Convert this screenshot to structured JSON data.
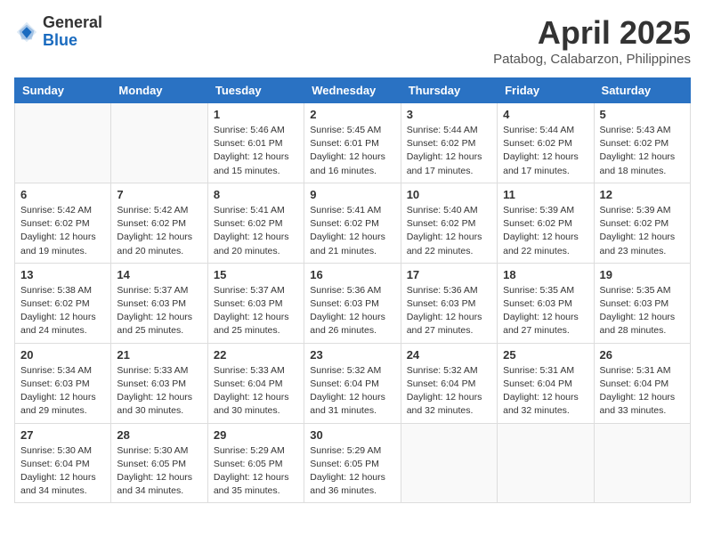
{
  "header": {
    "logo_general": "General",
    "logo_blue": "Blue",
    "month": "April 2025",
    "location": "Patabog, Calabarzon, Philippines"
  },
  "columns": [
    "Sunday",
    "Monday",
    "Tuesday",
    "Wednesday",
    "Thursday",
    "Friday",
    "Saturday"
  ],
  "weeks": [
    [
      {
        "day": "",
        "info": ""
      },
      {
        "day": "",
        "info": ""
      },
      {
        "day": "1",
        "info": "Sunrise: 5:46 AM\nSunset: 6:01 PM\nDaylight: 12 hours and 15 minutes."
      },
      {
        "day": "2",
        "info": "Sunrise: 5:45 AM\nSunset: 6:01 PM\nDaylight: 12 hours and 16 minutes."
      },
      {
        "day": "3",
        "info": "Sunrise: 5:44 AM\nSunset: 6:02 PM\nDaylight: 12 hours and 17 minutes."
      },
      {
        "day": "4",
        "info": "Sunrise: 5:44 AM\nSunset: 6:02 PM\nDaylight: 12 hours and 17 minutes."
      },
      {
        "day": "5",
        "info": "Sunrise: 5:43 AM\nSunset: 6:02 PM\nDaylight: 12 hours and 18 minutes."
      }
    ],
    [
      {
        "day": "6",
        "info": "Sunrise: 5:42 AM\nSunset: 6:02 PM\nDaylight: 12 hours and 19 minutes."
      },
      {
        "day": "7",
        "info": "Sunrise: 5:42 AM\nSunset: 6:02 PM\nDaylight: 12 hours and 20 minutes."
      },
      {
        "day": "8",
        "info": "Sunrise: 5:41 AM\nSunset: 6:02 PM\nDaylight: 12 hours and 20 minutes."
      },
      {
        "day": "9",
        "info": "Sunrise: 5:41 AM\nSunset: 6:02 PM\nDaylight: 12 hours and 21 minutes."
      },
      {
        "day": "10",
        "info": "Sunrise: 5:40 AM\nSunset: 6:02 PM\nDaylight: 12 hours and 22 minutes."
      },
      {
        "day": "11",
        "info": "Sunrise: 5:39 AM\nSunset: 6:02 PM\nDaylight: 12 hours and 22 minutes."
      },
      {
        "day": "12",
        "info": "Sunrise: 5:39 AM\nSunset: 6:02 PM\nDaylight: 12 hours and 23 minutes."
      }
    ],
    [
      {
        "day": "13",
        "info": "Sunrise: 5:38 AM\nSunset: 6:02 PM\nDaylight: 12 hours and 24 minutes."
      },
      {
        "day": "14",
        "info": "Sunrise: 5:37 AM\nSunset: 6:03 PM\nDaylight: 12 hours and 25 minutes."
      },
      {
        "day": "15",
        "info": "Sunrise: 5:37 AM\nSunset: 6:03 PM\nDaylight: 12 hours and 25 minutes."
      },
      {
        "day": "16",
        "info": "Sunrise: 5:36 AM\nSunset: 6:03 PM\nDaylight: 12 hours and 26 minutes."
      },
      {
        "day": "17",
        "info": "Sunrise: 5:36 AM\nSunset: 6:03 PM\nDaylight: 12 hours and 27 minutes."
      },
      {
        "day": "18",
        "info": "Sunrise: 5:35 AM\nSunset: 6:03 PM\nDaylight: 12 hours and 27 minutes."
      },
      {
        "day": "19",
        "info": "Sunrise: 5:35 AM\nSunset: 6:03 PM\nDaylight: 12 hours and 28 minutes."
      }
    ],
    [
      {
        "day": "20",
        "info": "Sunrise: 5:34 AM\nSunset: 6:03 PM\nDaylight: 12 hours and 29 minutes."
      },
      {
        "day": "21",
        "info": "Sunrise: 5:33 AM\nSunset: 6:03 PM\nDaylight: 12 hours and 30 minutes."
      },
      {
        "day": "22",
        "info": "Sunrise: 5:33 AM\nSunset: 6:04 PM\nDaylight: 12 hours and 30 minutes."
      },
      {
        "day": "23",
        "info": "Sunrise: 5:32 AM\nSunset: 6:04 PM\nDaylight: 12 hours and 31 minutes."
      },
      {
        "day": "24",
        "info": "Sunrise: 5:32 AM\nSunset: 6:04 PM\nDaylight: 12 hours and 32 minutes."
      },
      {
        "day": "25",
        "info": "Sunrise: 5:31 AM\nSunset: 6:04 PM\nDaylight: 12 hours and 32 minutes."
      },
      {
        "day": "26",
        "info": "Sunrise: 5:31 AM\nSunset: 6:04 PM\nDaylight: 12 hours and 33 minutes."
      }
    ],
    [
      {
        "day": "27",
        "info": "Sunrise: 5:30 AM\nSunset: 6:04 PM\nDaylight: 12 hours and 34 minutes."
      },
      {
        "day": "28",
        "info": "Sunrise: 5:30 AM\nSunset: 6:05 PM\nDaylight: 12 hours and 34 minutes."
      },
      {
        "day": "29",
        "info": "Sunrise: 5:29 AM\nSunset: 6:05 PM\nDaylight: 12 hours and 35 minutes."
      },
      {
        "day": "30",
        "info": "Sunrise: 5:29 AM\nSunset: 6:05 PM\nDaylight: 12 hours and 36 minutes."
      },
      {
        "day": "",
        "info": ""
      },
      {
        "day": "",
        "info": ""
      },
      {
        "day": "",
        "info": ""
      }
    ]
  ]
}
